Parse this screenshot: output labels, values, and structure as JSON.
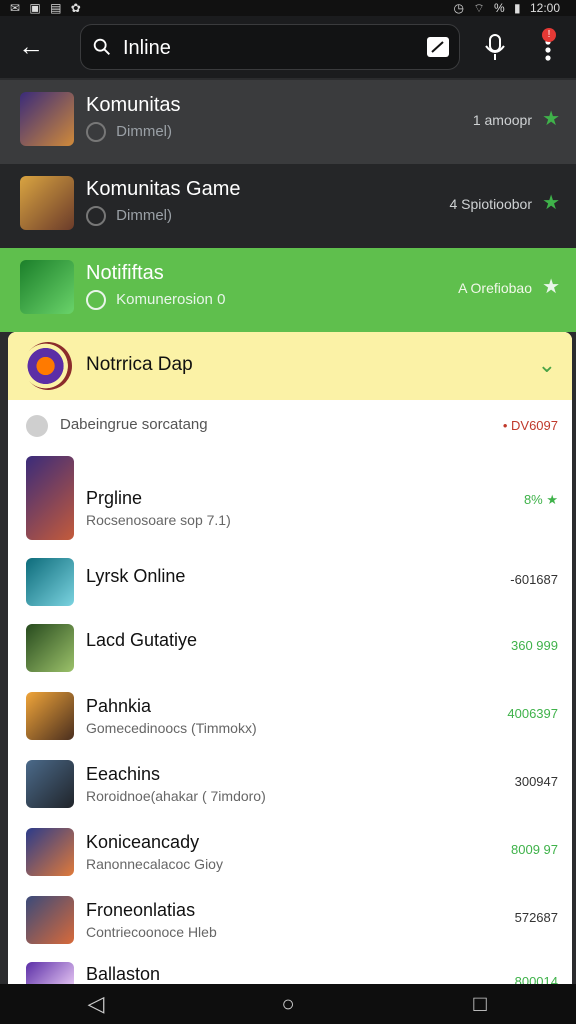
{
  "status_bar": {
    "left_icons": [
      "mail-icon",
      "image-icon",
      "gallery-icon",
      "settings-icon"
    ],
    "right": {
      "icons": [
        "alarm-icon",
        "wifi-icon",
        "battery-icon"
      ],
      "battery": "%",
      "time": "12:00"
    }
  },
  "topbar": {
    "search_value": "Inline",
    "back_icon": "arrow-left",
    "mic_icon": "mic",
    "more_icon": "more-vertical",
    "badge": "!"
  },
  "top_list": [
    {
      "title": "Komunitas",
      "sub": "Dimmel)",
      "meta": "1 amoopr",
      "star_color": "#3fb24a",
      "bg": "#3a3b3d"
    },
    {
      "title": "Komunitas Game",
      "sub": "Dimmel)",
      "meta": "4 Spiotioobor",
      "star_color": "#3fb24a",
      "bg": "#252628"
    },
    {
      "title": "Notififtas",
      "sub": "Komunerosion 0",
      "meta": "A Orefiobao",
      "star_color": "#e8f5e9",
      "bg": "#5fbf4d"
    }
  ],
  "card": {
    "title": "Notrrica Dap",
    "chevron": "expand-icon",
    "subheader": {
      "text": "Dabeingrue sorcatang",
      "badge": "• DV6097"
    },
    "items": [
      {
        "title": "Prgline",
        "sub": "Rocsenosoare sop 7.1)",
        "value": "8% ★",
        "value_color": "#3fb24a"
      },
      {
        "title": "Lyrsk Online",
        "sub": "",
        "value": "-601687",
        "value_color": "#333333"
      },
      {
        "title": "Lacd Gutatiye",
        "sub": "",
        "value": "360 999",
        "value_color": "#3fb24a"
      },
      {
        "title": "Pahnkia",
        "sub": "Gomecedinoocs (Timmokx)",
        "value": "4006397",
        "value_color": "#3fb24a"
      },
      {
        "title": "Eeachins",
        "sub": "Roroidnoe(ahakar ( 7imdoro)",
        "value": "300947",
        "value_color": "#333333"
      },
      {
        "title": "Koniceancady",
        "sub": "Ranonnecalacoc Gioy",
        "value": "8009 97",
        "value_color": "#3fb24a"
      },
      {
        "title": "Froneonlatias",
        "sub": "Contriecoonoce Hleb",
        "value": "572687",
        "value_color": "#333333"
      },
      {
        "title": "Ballaston",
        "sub": "",
        "value": "800014",
        "value_color": "#3fb24a"
      }
    ]
  },
  "navbar": {
    "back": "◁",
    "home": "○",
    "recent": "□"
  }
}
